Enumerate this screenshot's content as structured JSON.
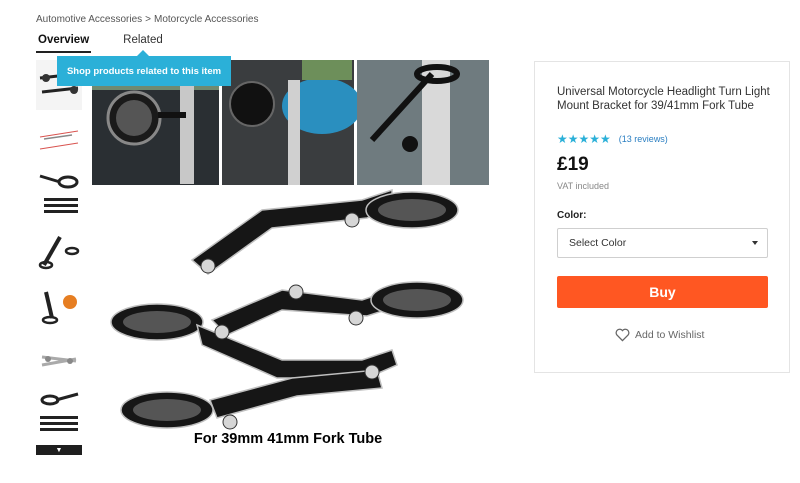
{
  "breadcrumb": {
    "items": [
      "Automotive Accessories",
      "Motorcycle Accessories"
    ],
    "separator": ">"
  },
  "tabs": [
    {
      "label": "Overview",
      "active": true
    },
    {
      "label": "Related",
      "active": false
    }
  ],
  "tooltip": {
    "text": "Shop products related to this item"
  },
  "product": {
    "title": "Universal Motorcycle Headlight Turn Light Mount Bracket for 39/41mm Fork Tube",
    "rating": 4.5,
    "stars": "★★★★★",
    "reviews": "(13 reviews)",
    "price": "£19",
    "vat_note": "VAT included",
    "color_label": "Color:",
    "color_select": "Select Color",
    "buy_label": "Buy",
    "wishlist_label": "Add to Wishlist",
    "image_caption": "For 39mm 41mm Fork Tube"
  },
  "colors": {
    "accent": "#2bb0d8",
    "buy": "#ff5722",
    "link": "#2b7fc2"
  },
  "icons": {
    "heart": "heart-icon",
    "caret": "chevron-down-icon",
    "more": "arrow-down-icon"
  },
  "thumbnails_more": "▼"
}
